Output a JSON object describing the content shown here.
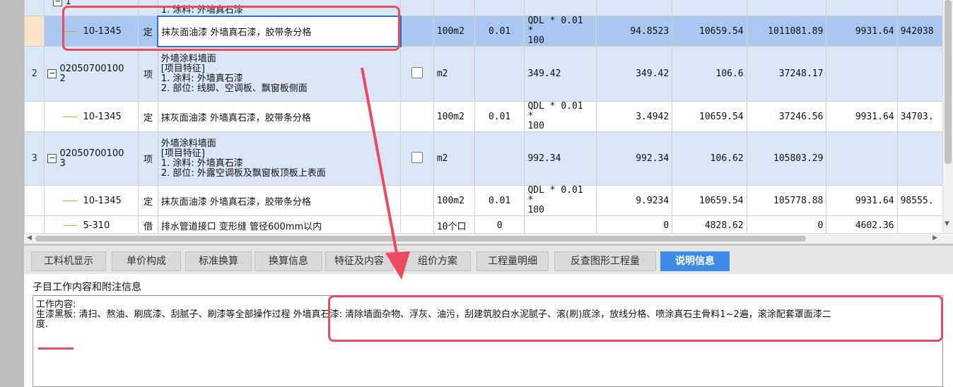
{
  "grid": {
    "rows": [
      {
        "type": "partial",
        "code": "1",
        "desc": "1. 涂料: 外墙真石漆"
      },
      {
        "type": "sub",
        "code": "10-1345",
        "kind": "定",
        "name": "抹灰面油漆 外墙真石漆，胶带条分格",
        "unit": "100m2",
        "qty": "0.01",
        "expr_line1": "QDL * 0.01 *",
        "expr_line2": "100",
        "quantity": "94.8523",
        "price": "10659.54",
        "total": "1011081.89",
        "labor": "9931.64",
        "labor_total": "942038"
      },
      {
        "type": "item",
        "no": "2",
        "code_line1": "02050700100",
        "code_line2": "2",
        "kind": "项",
        "desc_lines": [
          "外墙涂料墙面",
          "[项目特征]",
          "1. 涂料: 外墙真石漆",
          "2. 部位: 线脚、空调板、飘窗板侧面"
        ],
        "unit": "m2",
        "expr": "349.42",
        "quantity": "349.42",
        "price": "106.6",
        "total": "37248.17"
      },
      {
        "type": "sub",
        "code": "10-1345",
        "kind": "定",
        "name": "抹灰面油漆 外墙真石漆，胶带条分格",
        "unit": "100m2",
        "qty": "0.01",
        "expr_line1": "QDL * 0.01 *",
        "expr_line2": "100",
        "quantity": "3.4942",
        "price": "10659.54",
        "total": "37246.56",
        "labor": "9931.64",
        "labor_total": "34703."
      },
      {
        "type": "item",
        "no": "3",
        "code_line1": "02050700100",
        "code_line2": "3",
        "kind": "项",
        "desc_lines": [
          "外墙涂料墙面",
          "[项目特征]",
          "1. 涂料: 外墙真石漆",
          "2. 部位: 外露空调板及飘窗板顶板上表面"
        ],
        "unit": "m2",
        "expr": "992.34",
        "quantity": "992.34",
        "price": "106.62",
        "total": "105803.29"
      },
      {
        "type": "sub",
        "code": "10-1345",
        "kind": "定",
        "name": "抹灰面油漆 外墙真石漆，胶带条分格",
        "unit": "100m2",
        "qty": "0.01",
        "expr_line1": "QDL * 0.01 *",
        "expr_line2": "100",
        "quantity": "9.9234",
        "price": "10659.54",
        "total": "105778.88",
        "labor": "9931.64",
        "labor_total": "98555."
      },
      {
        "type": "sub",
        "code": "5-310",
        "kind": "借",
        "name": "排水管道接口 变形缝 管径600mm以内",
        "unit": "10个口",
        "qty": "0",
        "expr_line1": "",
        "expr_line2": "",
        "quantity": "0",
        "price": "4828.62",
        "total": "0",
        "labor": "4602.36",
        "labor_total": ""
      }
    ]
  },
  "tabs": [
    "工料机显示",
    "单价构成",
    "标准换算",
    "换算信息",
    "特征及内容",
    "组价方案",
    "工程量明细",
    "反查图形工程量",
    "说明信息"
  ],
  "active_tab": "说明信息",
  "panel": {
    "title": "子目工作内容和附注信息",
    "line1": "工作内容:",
    "line2": "生漆黑板: 清扫、熬油、刷底漆、刮腻子、刷漆等全部操作过程 外墙真石漆: 清除墙面杂物、浮灰、油污，刮建筑胶白水泥腻子、滚(刷)底涂，放线分格、喷涂真石主骨料1~2遍，滚涂配套罩面漆二",
    "line3": "度."
  },
  "colors": {
    "highlight": "#ec4b60",
    "selected_row": "#a9c7f0",
    "item_row": "#dbe6f6",
    "active_tab": "#3f8be8"
  }
}
